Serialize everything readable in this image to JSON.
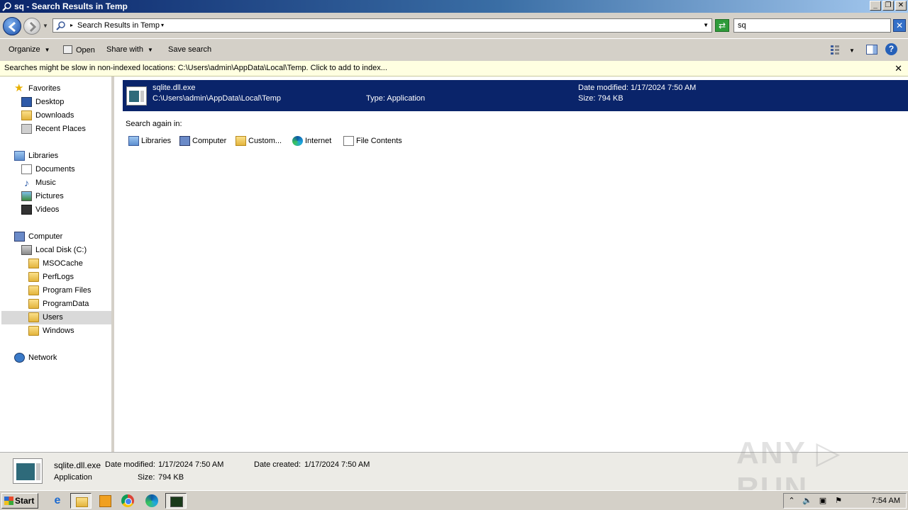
{
  "window": {
    "title": "sq - Search Results in Temp",
    "buttons": {
      "minimize": "_",
      "restore": "❐",
      "close": "✕"
    }
  },
  "address": {
    "breadcrumb": "Search Results in Temp",
    "search_value": "sq"
  },
  "toolbar": {
    "organize": "Organize",
    "open": "Open",
    "share_with": "Share with",
    "save_search": "Save search",
    "help": "?"
  },
  "infobar": {
    "message": "Searches might be slow in non-indexed locations: C:\\Users\\admin\\AppData\\Local\\Temp. Click to add to index...",
    "close": "✕"
  },
  "nav": {
    "favorites": "Favorites",
    "desktop": "Desktop",
    "downloads": "Downloads",
    "recent_places": "Recent Places",
    "libraries": "Libraries",
    "documents": "Documents",
    "music": "Music",
    "pictures": "Pictures",
    "videos": "Videos",
    "computer": "Computer",
    "local_disk": "Local Disk (C:)",
    "msocache": "MSOCache",
    "perflogs": "PerfLogs",
    "program_files": "Program Files",
    "programdata": "ProgramData",
    "users": "Users",
    "windows": "Windows",
    "network": "Network"
  },
  "result": {
    "name": "sqlite.dll.exe",
    "path": "C:\\Users\\admin\\AppData\\Local\\Temp",
    "type": "Type: Application",
    "modified": "Date modified: 1/17/2024 7:50 AM",
    "size": "Size: 794 KB"
  },
  "search_again": {
    "heading": "Search again in:",
    "libraries": "Libraries",
    "computer": "Computer",
    "custom": "Custom...",
    "internet": "Internet",
    "file_contents": "File Contents"
  },
  "details": {
    "name": "sqlite.dll.exe",
    "type": "Application",
    "modified_label": "Date modified:",
    "modified_value": "1/17/2024 7:50 AM",
    "created_label": "Date created:",
    "created_value": "1/17/2024 7:50 AM",
    "size_label": "Size:",
    "size_value": "794 KB"
  },
  "watermark": "ANY ▷ RUN",
  "taskbar": {
    "start": "Start",
    "time": "7:54 AM"
  }
}
